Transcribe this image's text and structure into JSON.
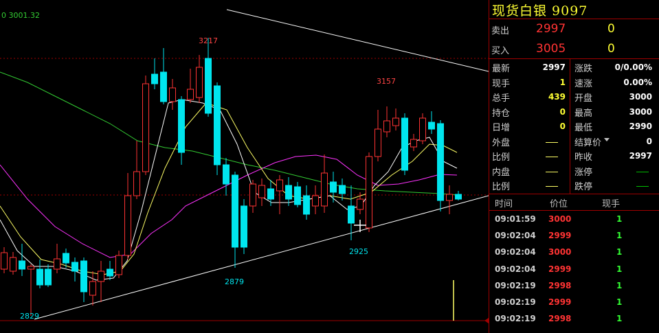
{
  "chart_data": {
    "type": "candlestick",
    "price_max_label": "0 3001.32",
    "annotations": {
      "high": "3217",
      "low_left": "2829",
      "low_mid": "2879",
      "high_right": "3157",
      "low_right": "2925"
    }
  },
  "colors": {
    "up": "#ff3333",
    "down": "#00e5ee",
    "ma5": "#ffffff",
    "ma10": "#ffff66",
    "ma20": "#ff33ff",
    "ma60": "#33cc33"
  },
  "panel": {
    "title": "现货白银 9097",
    "sell": {
      "label": "卖出",
      "price": "2997",
      "qty": "0"
    },
    "buy": {
      "label": "买入",
      "price": "3005",
      "qty": "0"
    },
    "stats_left": [
      {
        "label": "最新",
        "value": "2997"
      },
      {
        "label": "现手",
        "value": "1"
      },
      {
        "label": "总手",
        "value": "439"
      },
      {
        "label": "持仓",
        "value": "0"
      },
      {
        "label": "日增",
        "value": "0"
      },
      {
        "label": "外盘",
        "value": ""
      },
      {
        "label": "比例",
        "value": ""
      },
      {
        "label": "内盘",
        "value": ""
      },
      {
        "label": "比例",
        "value": ""
      }
    ],
    "stats_right": [
      {
        "label": "涨跌",
        "value": "0/0.00%"
      },
      {
        "label": "速涨",
        "value": "0.00%"
      },
      {
        "label": "开盘",
        "value": "3000"
      },
      {
        "label": "最高",
        "value": "3000"
      },
      {
        "label": "最低",
        "value": "2990"
      },
      {
        "label": "结算价",
        "value": "0"
      },
      {
        "label": "昨收",
        "value": "2997"
      },
      {
        "label": "涨停",
        "value": ""
      },
      {
        "label": "跌停",
        "value": ""
      }
    ],
    "trades_header": {
      "time": "时间",
      "price": "价位",
      "qty": "现手"
    },
    "trades": [
      {
        "time": "09:01:59",
        "price": "3000",
        "qty": "1"
      },
      {
        "time": "09:02:04",
        "price": "2999",
        "qty": "1"
      },
      {
        "time": "09:02:04",
        "price": "3000",
        "qty": "1"
      },
      {
        "time": "09:02:04",
        "price": "2999",
        "qty": "1"
      },
      {
        "time": "09:02:19",
        "price": "2998",
        "qty": "1"
      },
      {
        "time": "09:02:19",
        "price": "2999",
        "qty": "1"
      },
      {
        "time": "09:02:19",
        "price": "2998",
        "qty": "1"
      }
    ]
  }
}
